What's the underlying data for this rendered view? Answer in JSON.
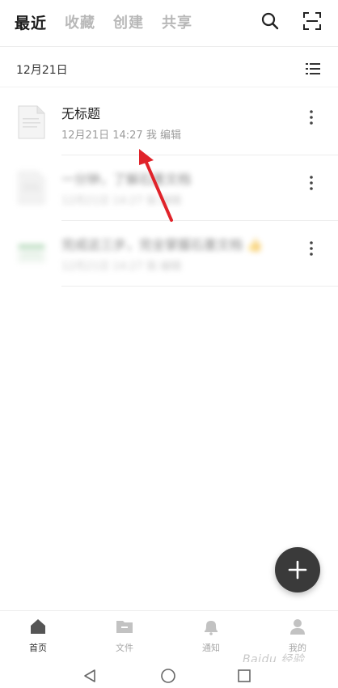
{
  "tabs": [
    {
      "label": "最近",
      "active": true
    },
    {
      "label": "收藏",
      "active": false
    },
    {
      "label": "创建",
      "active": false
    },
    {
      "label": "共享",
      "active": false
    }
  ],
  "top_icons": [
    "search-icon",
    "scan-icon"
  ],
  "section": {
    "date": "12月21日",
    "view_icon": "list-view-icon"
  },
  "items": [
    {
      "title": "无标题",
      "meta": "12月21日 14:27 我 编辑",
      "blurred": false
    },
    {
      "title": "一分钟，了解石墨文档",
      "meta": "12月21日 14:27 我 编辑",
      "blurred": true
    },
    {
      "title": "完成这三步，完全掌握石墨文档 👍",
      "meta": "12月21日 14:27 我 编辑",
      "blurred": true
    }
  ],
  "fab": {
    "icon": "plus-icon"
  },
  "bottom_nav": [
    {
      "label": "首页",
      "icon": "home-icon",
      "active": true
    },
    {
      "label": "文件",
      "icon": "folder-icon",
      "active": false
    },
    {
      "label": "通知",
      "icon": "bell-icon",
      "active": false
    },
    {
      "label": "我的",
      "icon": "user-icon",
      "active": false
    }
  ],
  "system_nav": [
    "back-icon",
    "home-circle-icon",
    "recents-icon"
  ],
  "watermark": "Baidu 经验",
  "colors": {
    "accent_dark": "#3a3a3a",
    "annotation_arrow": "#e0232a",
    "muted": "#b8b8b8"
  }
}
